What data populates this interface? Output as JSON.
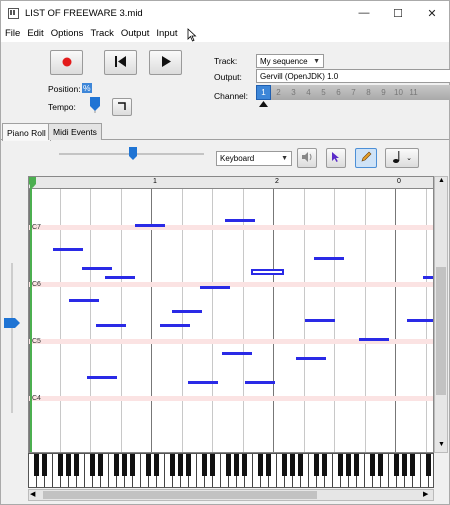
{
  "window": {
    "title": "LIST OF FREEWARE 3.mid",
    "minimize": "—",
    "maximize": "☐",
    "close": "✕"
  },
  "menu": [
    "File",
    "Edit",
    "Options",
    "Track",
    "Output",
    "Input"
  ],
  "transport": {
    "position_label": "Position:",
    "position_value": "%",
    "tempo_label": "Tempo:"
  },
  "track": {
    "label": "Track:",
    "value": "My sequence"
  },
  "output": {
    "label": "Output:",
    "value": "Gervill (OpenJDK) 1.0"
  },
  "channel": {
    "label": "Channel:",
    "values": [
      "1",
      "2",
      "3",
      "4",
      "5",
      "6",
      "7",
      "8",
      "9",
      "10",
      "11"
    ],
    "selected": "1"
  },
  "tabs": [
    "Piano Roll",
    "Midi Events"
  ],
  "toolbar": {
    "mode": "Keyboard"
  },
  "ruler": {
    "marks": [
      "1",
      "2",
      "0"
    ]
  },
  "octaves": [
    "C7",
    "C6",
    "C5",
    "C4"
  ],
  "colors": {
    "note": "#2a2ae6",
    "channel_selected": "#3d86d8",
    "cursor": "#4caf50"
  }
}
